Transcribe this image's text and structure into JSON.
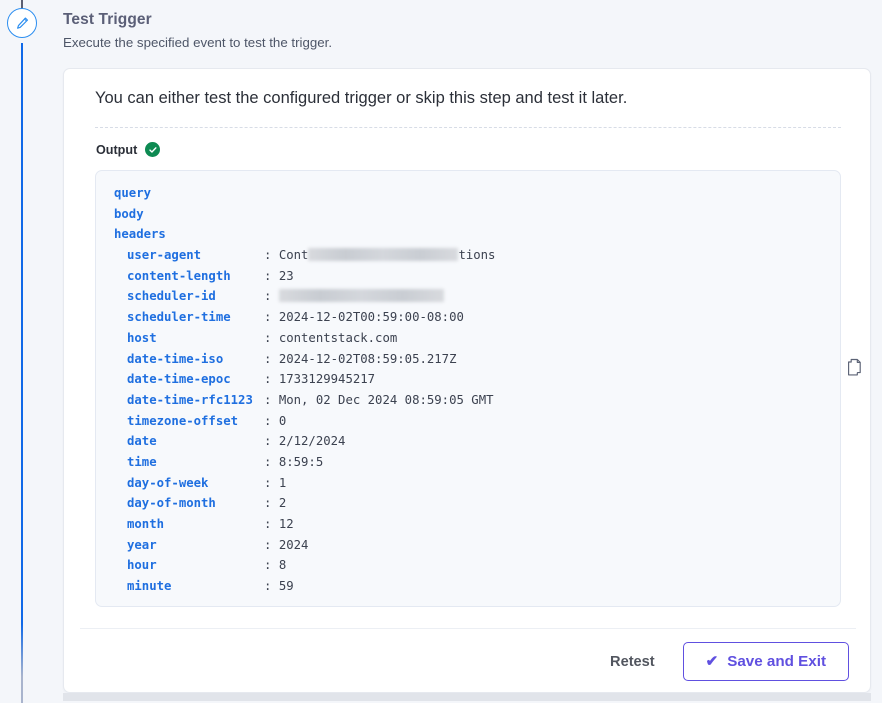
{
  "rail": {
    "node_icon": "pencil-icon"
  },
  "header": {
    "title": "Test Trigger",
    "subtitle": "Execute the specified event to test the trigger."
  },
  "card": {
    "headline": "You can either test the configured trigger or skip this step and test it later.",
    "output_label": "Output",
    "output_status_icon": "check-circle-icon",
    "copy_icon": "copy-icon"
  },
  "output": {
    "top_keys": [
      "query",
      "body",
      "headers"
    ],
    "headers": [
      {
        "key": "user-agent",
        "value": "Cont",
        "redacted": true,
        "redact_after": "tions",
        "redact_width": 150
      },
      {
        "key": "content-length",
        "value": "23"
      },
      {
        "key": "scheduler-id",
        "value": "",
        "redacted": true,
        "redact_after": "",
        "redact_width": 165
      },
      {
        "key": "scheduler-time",
        "value": "2024-12-02T00:59:00-08:00"
      },
      {
        "key": "host",
        "value": "contentstack.com"
      },
      {
        "key": "date-time-iso",
        "value": "2024-12-02T08:59:05.217Z"
      },
      {
        "key": "date-time-epoc",
        "value": "1733129945217"
      },
      {
        "key": "date-time-rfc1123",
        "value": "Mon, 02 Dec 2024 08:59:05 GMT"
      },
      {
        "key": "timezone-offset",
        "value": "0"
      },
      {
        "key": "date",
        "value": "2/12/2024"
      },
      {
        "key": "time",
        "value": "8:59:5"
      },
      {
        "key": "day-of-week",
        "value": "1"
      },
      {
        "key": "day-of-month",
        "value": "2"
      },
      {
        "key": "month",
        "value": "12"
      },
      {
        "key": "year",
        "value": "2024"
      },
      {
        "key": "hour",
        "value": "8"
      },
      {
        "key": "minute",
        "value": "59"
      }
    ]
  },
  "footer": {
    "retest_label": "Retest",
    "save_label": "Save and Exit",
    "save_icon": "check-icon"
  },
  "colors": {
    "page_background": "#f4f6fa",
    "card_background": "#ffffff",
    "code_background": "#f7f9fc",
    "key_blue": "#1f6fe0",
    "value_gray": "#3c4250",
    "accent_purple": "#6050e0",
    "status_green": "#0d8a52",
    "rail_blue": "#1069e8"
  }
}
